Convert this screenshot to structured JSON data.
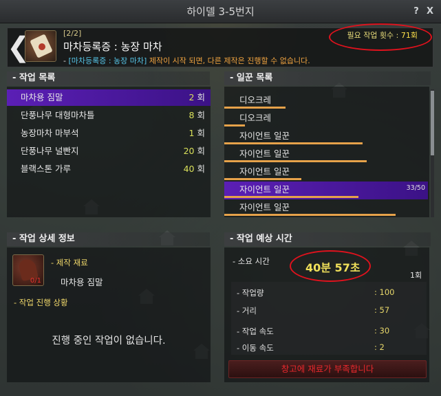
{
  "window": {
    "title": "하이델 3-5번지",
    "help_label": "?",
    "close_label": "X"
  },
  "header": {
    "stage": "[2/2]",
    "recipe_title": "마차등록증 : 농장 마차",
    "note_prefix": "- ",
    "note_tag": "[마차등록증 : 농장 마차]",
    "note_warning": " 제작이 시작 되면, 다른 제작은 진행할 수 없습니다.",
    "required_label": "필요 작업 횟수 : ",
    "required_value": "71회"
  },
  "work_list": {
    "title": "- 작업 목록",
    "unit": "회",
    "items": [
      {
        "name": "마차용 짐말",
        "count": "2",
        "selected": true
      },
      {
        "name": "단풍나무 대형마차틀",
        "count": "8",
        "selected": false
      },
      {
        "name": "농장마차 마부석",
        "count": "1",
        "selected": false
      },
      {
        "name": "단풍나무 널빤지",
        "count": "20",
        "selected": false
      },
      {
        "name": "블랙스톤 가루",
        "count": "40",
        "selected": false
      }
    ]
  },
  "worker_list": {
    "title": "- 일꾼 목록",
    "workers": [
      {
        "name": "디오크레",
        "stamina_fraction": 0.3,
        "selected": false,
        "stamina_text": ""
      },
      {
        "name": "디오크레",
        "stamina_fraction": 0.1,
        "selected": false,
        "stamina_text": ""
      },
      {
        "name": "자이언트 일꾼",
        "stamina_fraction": 0.68,
        "selected": false,
        "stamina_text": ""
      },
      {
        "name": "자이언트 일꾼",
        "stamina_fraction": 0.7,
        "selected": false,
        "stamina_text": ""
      },
      {
        "name": "자이언트 일꾼",
        "stamina_fraction": 0.38,
        "selected": false,
        "stamina_text": ""
      },
      {
        "name": "자이언트 일꾼",
        "stamina_fraction": 0.66,
        "selected": true,
        "stamina_text": "33/50"
      },
      {
        "name": "자이언트 일꾼",
        "stamina_fraction": 0.84,
        "selected": false,
        "stamina_text": ""
      }
    ]
  },
  "work_detail": {
    "title": "- 작업 상세 정보",
    "material_label": "- 제작 재료",
    "material_name": "마차용 짐말",
    "material_count": "0/1",
    "progress_label": "- 작업 진행 상황",
    "empty_message": "진행 중인 작업이 없습니다."
  },
  "estimated_time": {
    "title": "- 작업 예상 시간",
    "duration_label": "- 소요 시간",
    "duration_value": "40분 57초",
    "repeat": "1회",
    "stats": [
      {
        "label": "- 작업량",
        "value": ": 100"
      },
      {
        "label": "- 거리",
        "value": ": 57"
      },
      {
        "label": "- 작업 속도",
        "value": ": 30"
      },
      {
        "label": "- 이동 속도",
        "value": ": 2"
      }
    ],
    "status_button": "창고에 재료가 부족합니다"
  },
  "colors": {
    "selection": "#5b1fb5",
    "stamina_bar": "#e6a24a",
    "highlight_ellipse": "#e0121d",
    "count_yellow": "#d9e05a",
    "warning_red": "#e8282c"
  }
}
